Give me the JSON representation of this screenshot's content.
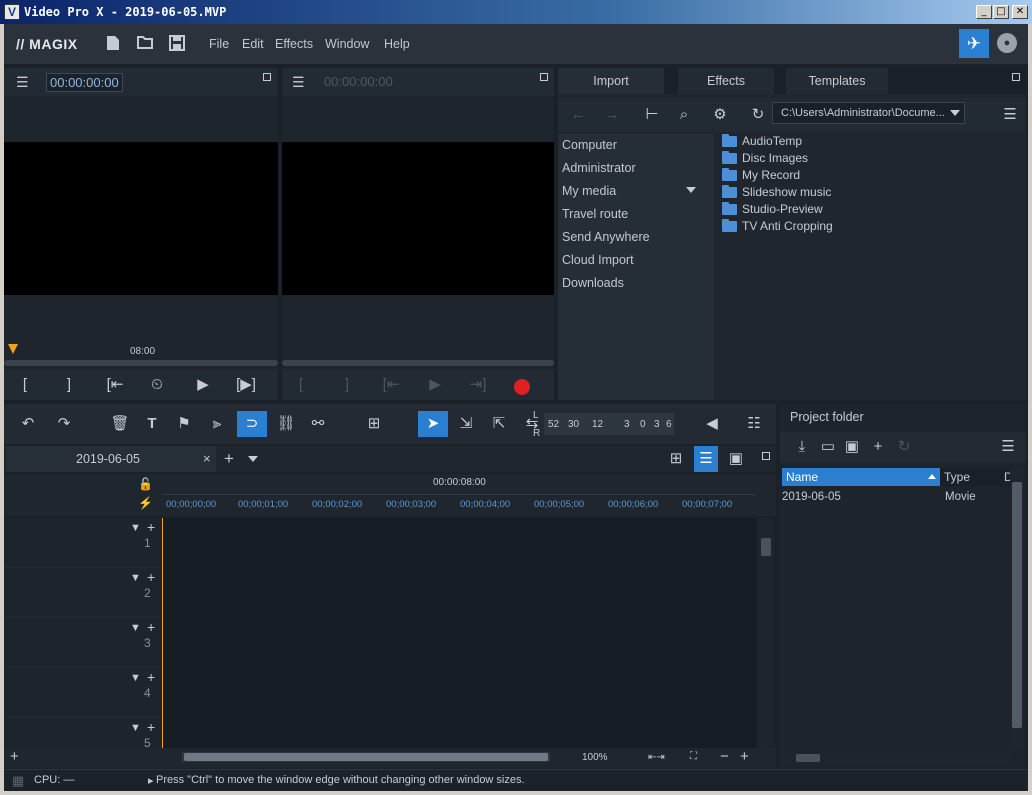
{
  "window": {
    "title": "Video Pro X - 2019-06-05.MVP",
    "app_icon": "V",
    "minimize_glyph": "_",
    "maximize_glyph": "□",
    "close_glyph": "✕"
  },
  "menubar": {
    "logo": "// MAGIX",
    "items": [
      "File",
      "Edit",
      "Effects",
      "Window",
      "Help"
    ]
  },
  "source_monitor": {
    "timecode": "00:00:00:00",
    "ruler_label": "08:00"
  },
  "program_monitor": {
    "timecode": "00:00:00:00"
  },
  "source_controls": {
    "mark_in": "[",
    "mark_out": "]",
    "go_to_start": "[⇤",
    "play": "▶",
    "go_to_end": "[▶]"
  },
  "program_controls": {
    "mark_in": "[",
    "mark_out": "]",
    "go_back": "[⇤",
    "play": "▶",
    "go_forward": "⇥]"
  },
  "media_pool": {
    "tabs": [
      "Import",
      "Effects",
      "Templates"
    ],
    "path": "C:\\Users\\Administrator\\Docume...",
    "nav": [
      "Computer",
      "Administrator",
      "My media",
      "Travel route",
      "Send Anywhere",
      "Cloud Import",
      "Downloads"
    ],
    "folders": [
      "AudioTemp",
      "Disc Images",
      "My Record",
      "Slideshow music",
      "Studio-Preview",
      "TV Anti Cropping"
    ]
  },
  "timeline": {
    "tab_name": "2019-06-05",
    "overview_time": "00:00:08:00",
    "ruler": [
      "00;00;00;00",
      "00;00;01;00",
      "00;00;02;00",
      "00;00;03;00",
      "00;00;04;00",
      "00;00;05;00",
      "00;00;06;00",
      "00;00;07;00"
    ],
    "tracks": [
      "1",
      "2",
      "3",
      "4",
      "5"
    ],
    "zoom": "100%",
    "meter_scale": [
      "52",
      "30",
      "12",
      "3",
      "0",
      "3",
      "6"
    ],
    "meter_l": "L",
    "meter_r": "R"
  },
  "project_folder": {
    "title": "Project folder",
    "columns": [
      "Name",
      "Type",
      "D"
    ],
    "rows": [
      {
        "name": "2019-06-05",
        "type": "Movie"
      }
    ]
  },
  "status": {
    "cpu": "CPU: —",
    "hint": "Press \"Ctrl\" to move the window edge without changing other window sizes."
  },
  "colors": {
    "accent": "#2a7fd0",
    "record": "#e02020",
    "playhead": "#f0a020",
    "timecode": "#8fb6e0"
  }
}
